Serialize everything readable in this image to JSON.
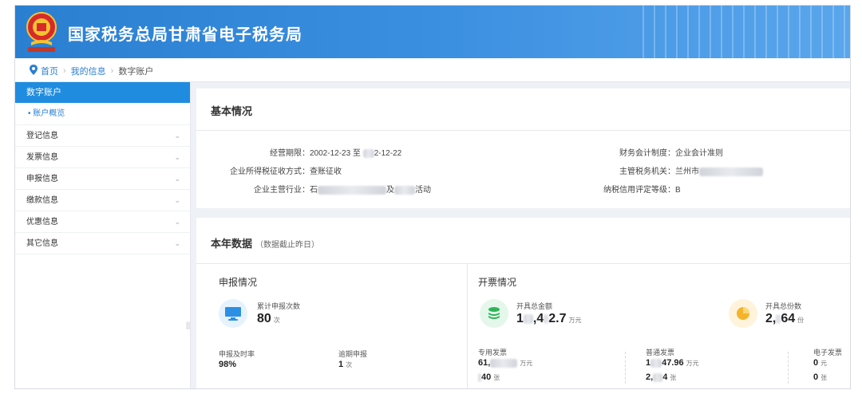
{
  "header": {
    "site_title": "国家税务总局甘肃省电子税务局",
    "emblem_icon": "tax-emblem-icon",
    "colors": {
      "primary": "#2a7fd1",
      "sidebar_active": "#1f8ce0"
    }
  },
  "breadcrumb": {
    "items": [
      "首页",
      "我的信息",
      "数字账户"
    ],
    "separator": "›"
  },
  "sidebar": {
    "header": "数字账户",
    "active_sub": "• 账户概览",
    "items": [
      {
        "label": "登记信息"
      },
      {
        "label": "发票信息"
      },
      {
        "label": "申报信息"
      },
      {
        "label": "缴款信息"
      },
      {
        "label": "优惠信息"
      },
      {
        "label": "其它信息"
      }
    ],
    "chevron": "⌄",
    "collapse_handle": "||"
  },
  "basic": {
    "title": "基本情况",
    "rows": [
      {
        "key": "经营期限：",
        "value_a": "2002-12-23 至 ",
        "value_b": "2-12-22"
      },
      {
        "key": "企业所得税征收方式：",
        "value_a": "查账征收",
        "value_b": ""
      },
      {
        "key": "企业主营行业：",
        "value_a": "石",
        "value_b": "及",
        "value_c": "活动"
      },
      {
        "key": "财务会计制度：",
        "value_a": "企业会计准则"
      },
      {
        "key": "主管税务机关：",
        "value_a": "兰州市"
      },
      {
        "key": "纳税信用评定等级：",
        "value_a": "B"
      }
    ]
  },
  "year": {
    "title": "本年数据",
    "note": "（数据截止昨日）",
    "declare": {
      "title": "申报情况",
      "total_label": "累计申报次数",
      "total_value": "80",
      "total_unit": "次",
      "ontime_label": "申报及时率",
      "ontime_value": "98%",
      "overdue_label": "逾期申报",
      "overdue_value": "1",
      "overdue_unit": "次"
    },
    "invoice": {
      "title": "开票情况",
      "amount_label": "开具总金额",
      "amount_value": "1",
      "amount_value_b": ",4",
      "amount_value_c": "2.7",
      "amount_unit": "万元",
      "count_label": "开具总份数",
      "count_value": "2,",
      "count_value_b": "64",
      "count_unit": "份",
      "special_label": "专用发票",
      "special_amount": "61,",
      "special_amount_unit": "万元",
      "special_count": "40",
      "special_count_unit": "张",
      "normal_label": "普通发票",
      "normal_amount": "1",
      "normal_amount_b": "47.96",
      "normal_amount_unit": "万元",
      "normal_count": "2,",
      "normal_count_b": "4",
      "normal_count_unit": "张",
      "electronic_label": "电子发票",
      "electronic_amount": "0",
      "electronic_amount_unit": "元",
      "electronic_count": "0",
      "electronic_count_unit": "张"
    }
  }
}
